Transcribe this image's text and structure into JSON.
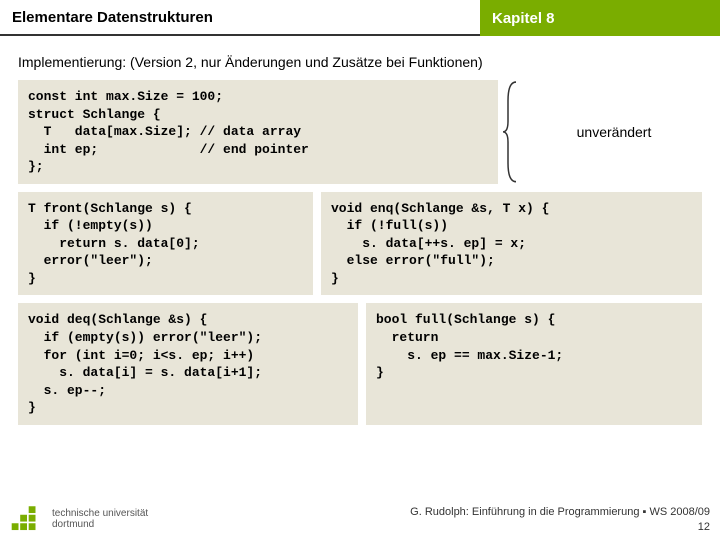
{
  "header": {
    "left": "Elementare Datenstrukturen",
    "right": "Kapitel 8"
  },
  "subtitle": "Implementierung: (Version 2, nur Änderungen und Zusätze bei Funktionen)",
  "unchanged_label": "unverändert",
  "code": {
    "struct": "const int max.Size = 100;\nstruct Schlange {\n  T   data[max.Size]; // data array\n  int ep;             // end pointer\n};",
    "front": "T front(Schlange s) {\n  if (!empty(s))\n    return s. data[0];\n  error(\"leer\");\n}",
    "enq": "void enq(Schlange &s, T x) {\n  if (!full(s))\n    s. data[++s. ep] = x;\n  else error(\"full\");\n}",
    "deq": "void deq(Schlange &s) {\n  if (empty(s)) error(\"leer\");\n  for (int i=0; i<s. ep; i++)\n    s. data[i] = s. data[i+1];\n  s. ep--;\n}",
    "full": "bool full(Schlange s) {\n  return\n    s. ep == max.Size-1;\n}"
  },
  "footer": {
    "uni1": "technische universität",
    "uni2": "dortmund",
    "credit": "G. Rudolph: Einführung in die Programmierung ▪ WS 2008/09",
    "page": "12"
  }
}
